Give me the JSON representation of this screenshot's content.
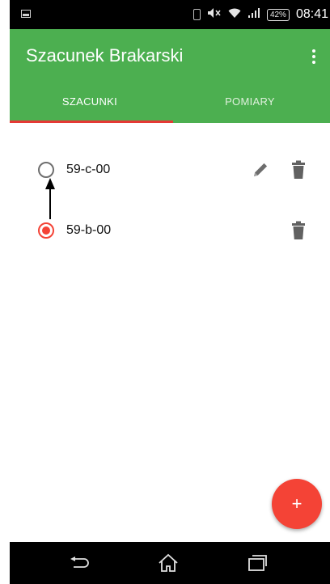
{
  "status_bar": {
    "battery": "42%",
    "time": "08:41",
    "icons": [
      "notification-icon",
      "vibrate-icon",
      "mute-icon",
      "wifi-icon",
      "signal-icon",
      "battery-icon"
    ]
  },
  "app_bar": {
    "title": "Szacunek Brakarski",
    "menu_icon": "overflow-menu-icon",
    "accent_color": "#4caf50"
  },
  "tabs": [
    {
      "label": "SZACUNKI",
      "selected": true
    },
    {
      "label": "POMIARY",
      "selected": false
    }
  ],
  "tab_indicator_color": "#e53935",
  "list": {
    "items": [
      {
        "label": "59-c-00",
        "selected": false,
        "actions": [
          "edit-icon",
          "delete-icon"
        ]
      },
      {
        "label": "59-b-00",
        "selected": true,
        "actions": [
          "delete-icon"
        ]
      }
    ]
  },
  "fab": {
    "label": "+",
    "color": "#f44336"
  },
  "nav_bar": {
    "buttons": [
      "back-icon",
      "home-icon",
      "recents-icon"
    ]
  }
}
